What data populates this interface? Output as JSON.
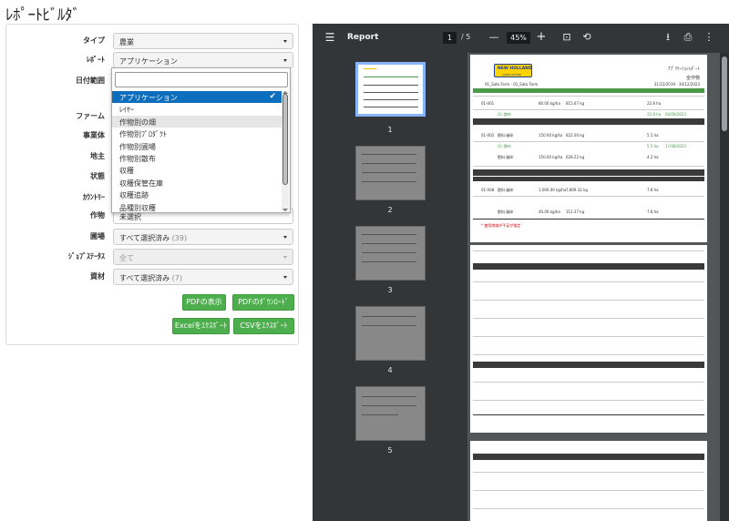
{
  "page_title": "ﾚﾎﾟｰﾄﾋﾞﾙﾀﾞ",
  "form": {
    "type_label": "タイプ",
    "type_value": "農業",
    "report_label": "ﾚﾎﾟｰﾄ",
    "report_value": "アプリケーション",
    "date_label": "日付範囲",
    "farm_label": "ファーム",
    "business_label": "事業体",
    "region_label": "地主",
    "status_label": "状態",
    "county_label": "ｶｳﾝﾄﾘｰ",
    "crop_label": "作物",
    "crop_value": "未選択",
    "field_label": "圃場",
    "field_value": "すべて選択済み",
    "field_count": "(39)",
    "job_status_label": "ｼﾞｮﾌﾞｽﾃｰﾀｽ",
    "job_status_value": "全て",
    "material_label": "資材",
    "material_value": "すべて選択済み",
    "material_count": "(7)"
  },
  "buttons": {
    "pdf_view": "PDFの表示",
    "pdf_download": "PDFのﾀﾞｳﾝﾛｰﾄﾞ",
    "excel_export": "Excelをｴｸｽﾎﾟｰﾄ",
    "csv_export": "CSVをｴｸｽﾎﾟｰﾄ"
  },
  "dropdown": {
    "options": [
      "アプリケーション",
      "ﾚｲﾔｰ",
      "作物別の畑",
      "作物別ﾌﾟﾛﾀﾞｸﾄ",
      "作物別圃場",
      "作物別散布",
      "収穫",
      "収穫保管在庫",
      "収穫追跡",
      "品種別収穫"
    ],
    "selected_index": 0,
    "hover_index": 2
  },
  "viewer": {
    "title": "Report",
    "page_current": "1",
    "page_total": "/ 5",
    "zoom": "45%",
    "thumbnails": [
      "1",
      "2",
      "3",
      "4",
      "5"
    ]
  },
  "report_page": {
    "brand": "NEW HOLLAND",
    "brand_sub": "AGRICULTURE",
    "heading": "ｱﾌﾟﾘｹｰｼｮﾝﾚﾎﾟｰﾄ",
    "subheading": "全作物",
    "farm_line": "01_Sato Farm - 01_Sato Farm",
    "date_range": "31/12/2019 - 30/12/2023",
    "footnote": "* 使用地域が不足が推定",
    "columns": [
      "圃場",
      "作物",
      "",
      "面積/ha",
      "合計散布",
      "面積/ha",
      "",
      "総散布面積",
      "単価",
      "ｽﾃｰﾄ",
      "",
      "散布日"
    ],
    "rows": [
      {
        "field": "01-001",
        "product": "",
        "rate": "80.00 kg/ha",
        "total": "815.67 kg",
        "area": "22.8 ha",
        "date": ""
      },
      {
        "field": "",
        "product": "(1) 散布",
        "rate": "",
        "total": "",
        "area": "22.8 ha",
        "date": "04/09/2023"
      },
      {
        "field": "01-002",
        "product": "肥料 破砕",
        "rate": "150.00 kg/ha",
        "total": "822.00 kg",
        "area": "5.5 ha",
        "date": ""
      },
      {
        "field": "",
        "product": "(1) 散布",
        "rate": "",
        "total": "",
        "area": "5.5 ha",
        "date": "17/08/2023"
      },
      {
        "field": "",
        "product": "肥料 破砕",
        "rate": "150.00 kg/ha",
        "total": "628.22 kg",
        "area": "4.2 ha",
        "date": ""
      },
      {
        "field": "01-008",
        "product": "肥料 破砕",
        "rate": "1,000.00 kg/ha",
        "total": "7,809.32 kg",
        "area": "7.8 ha",
        "date": ""
      },
      {
        "field": "",
        "product": "肥料 破砕",
        "rate": "40.00 kg/ha",
        "total": "312.37 kg",
        "area": "7.8 ha",
        "date": ""
      }
    ]
  },
  "colors": {
    "accent_green": "#4cae4c",
    "selected_blue": "#0d6ebd",
    "viewer_bg": "#525659",
    "toolbar_bg": "#323639"
  }
}
